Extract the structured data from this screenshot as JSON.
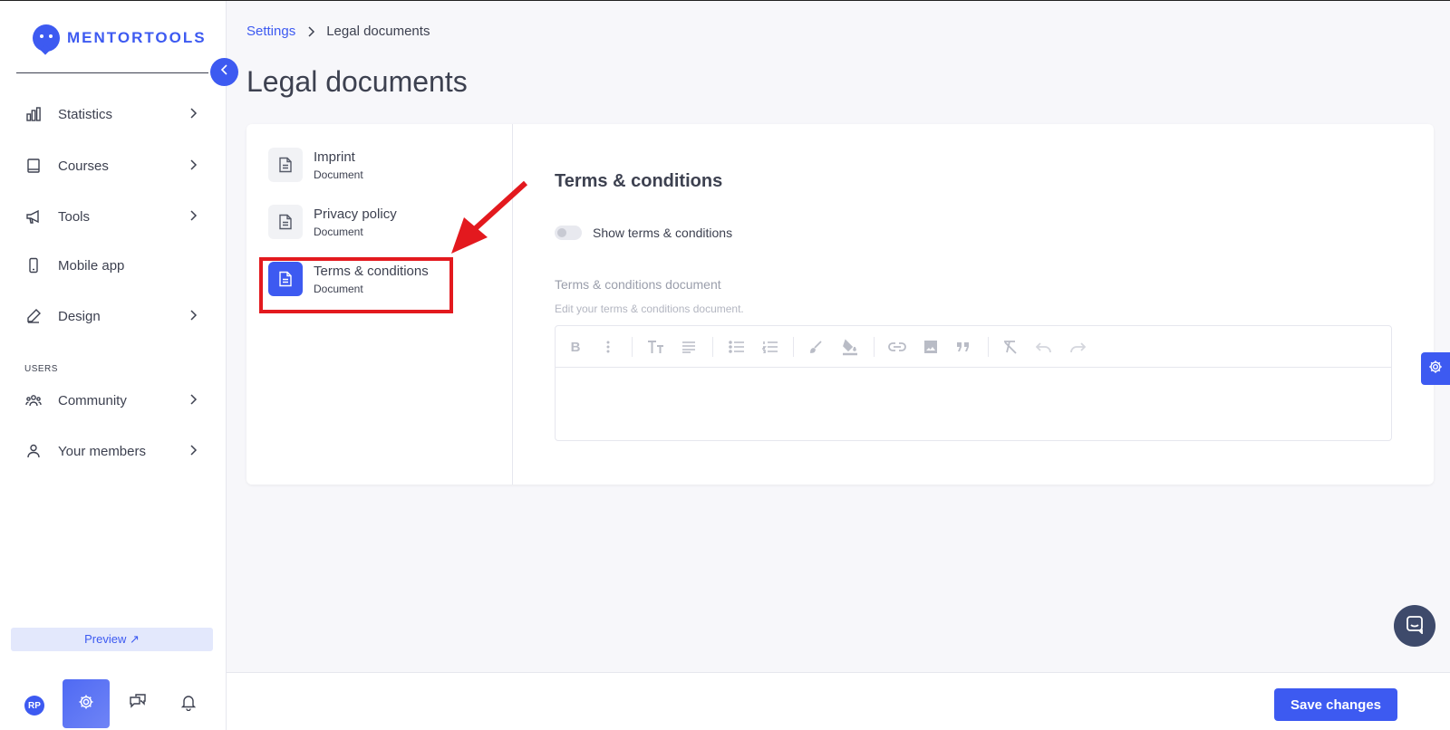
{
  "app": {
    "logo_text": "MENTORTOOLS"
  },
  "sidebar": {
    "items": [
      {
        "label": "Statistics",
        "icon": "bar-chart-icon"
      },
      {
        "label": "Courses",
        "icon": "book-icon"
      },
      {
        "label": "Tools",
        "icon": "megaphone-icon"
      },
      {
        "label": "Mobile app",
        "icon": "mobile-icon"
      },
      {
        "label": "Design",
        "icon": "pencil-icon"
      }
    ],
    "users_section": "USERS",
    "user_items": [
      {
        "label": "Community",
        "icon": "group-icon"
      },
      {
        "label": "Your members",
        "icon": "user-icon"
      }
    ],
    "preview_label": "Preview ↗",
    "avatar_initials": "RP"
  },
  "breadcrumb": {
    "parent": "Settings",
    "current": "Legal documents"
  },
  "page": {
    "title": "Legal documents"
  },
  "documents": [
    {
      "title": "Imprint",
      "subtitle": "Document",
      "active": false
    },
    {
      "title": "Privacy policy",
      "subtitle": "Document",
      "active": false
    },
    {
      "title": "Terms & conditions",
      "subtitle": "Document",
      "active": true
    }
  ],
  "content": {
    "section_title": "Terms & conditions",
    "toggle_label": "Show terms & conditions",
    "toggle_on": false,
    "field_label": "Terms & conditions document",
    "field_help": "Edit your terms & conditions document.",
    "toolbar": [
      "bold",
      "more",
      "text-size",
      "align",
      "bullet-list",
      "numbered-list",
      "brush",
      "fill-color",
      "link",
      "image",
      "quote",
      "clear-format",
      "undo",
      "redo"
    ]
  },
  "footer": {
    "save_label": "Save changes"
  },
  "colors": {
    "accent": "#3d5af1",
    "highlight": "#e3191e",
    "text": "#3d4150"
  }
}
